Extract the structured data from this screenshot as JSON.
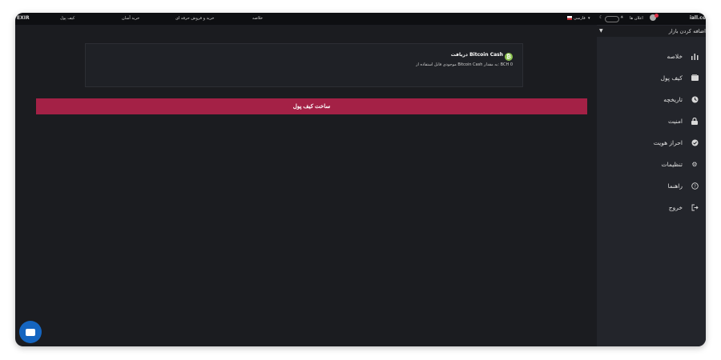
{
  "topbar": {
    "logo_left": "EXIR",
    "logo_right": "iall.co",
    "nav": [
      "کیف پول",
      "خرید آسان",
      "خرید و فروش حرفه ای",
      "خلاصه"
    ],
    "language": "فارسی",
    "notifications": "اعلان ها"
  },
  "sidebar": {
    "market_toggle": "اضافه کردن بازار",
    "items": [
      {
        "label": "خلاصه",
        "icon": "bar-chart-icon"
      },
      {
        "label": "کیف پول",
        "icon": "wallet-icon"
      },
      {
        "label": "تاریخچه",
        "icon": "history-icon"
      },
      {
        "label": "امنیت",
        "icon": "lock-icon"
      },
      {
        "label": "احراز هویت",
        "icon": "verified-icon"
      },
      {
        "label": "تنظیمات",
        "icon": "gear-icon"
      },
      {
        "label": "راهنما",
        "icon": "help-icon"
      },
      {
        "label": "خروج",
        "icon": "logout-icon"
      }
    ]
  },
  "deposit_card": {
    "title": "دریافت Bitcoin Cash",
    "coin_symbol": "₿",
    "description": "موجودی قابل استفاده از Bitcoin Cash به مقدار: BCH 0"
  },
  "create_wallet_button": "ساخت کیف پول",
  "colors": {
    "background": "#1b1c20",
    "sidebar": "#23252b",
    "accent": "#a42146",
    "coin": "#8dc351",
    "chat": "#1565c0"
  }
}
